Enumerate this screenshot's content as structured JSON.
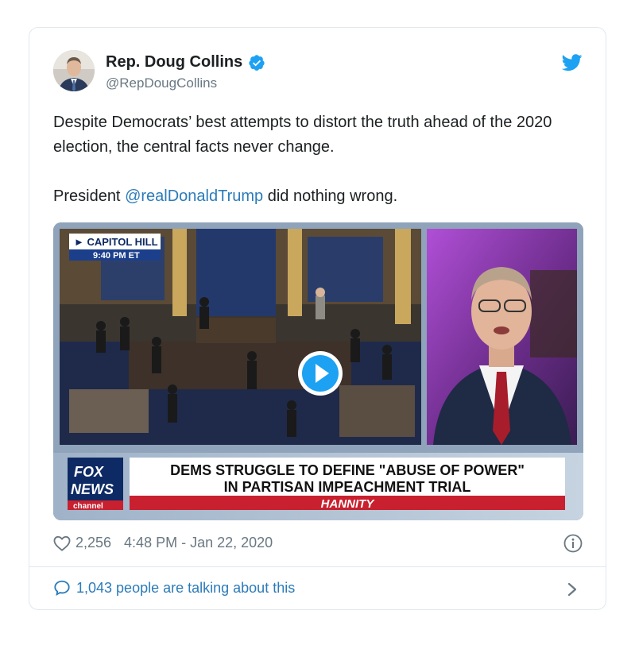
{
  "tweet": {
    "author_name": "Rep. Doug Collins",
    "handle": "@RepDougCollins",
    "text_line1": "Despite Democrats’ best attempts to distort the truth ahead of the 2020 election, the central facts never change.",
    "text_line2_prefix": "President ",
    "mention": "@realDonaldTrump",
    "text_line2_suffix": " did nothing wrong.",
    "likes": "2,256",
    "timestamp": "4:48 PM - Jan 22, 2020",
    "talking": "1,043 people are talking about this"
  },
  "video": {
    "location_tag": "► CAPITOL HILL",
    "time_tag": "9:40 PM ET",
    "headline_line1": "DEMS STRUGGLE TO DEFINE \"ABUSE OF POWER\"",
    "headline_line2": "IN PARTISAN IMPEACHMENT TRIAL",
    "show_name": "HANNITY",
    "logo_line1": "FOX",
    "logo_line2": "NEWS",
    "logo_line3": "channel"
  },
  "icons": {
    "verified": "verified-badge-icon",
    "bird": "twitter-bird-icon",
    "play": "play-icon",
    "heart": "heart-icon",
    "info": "info-icon",
    "bubble": "speech-bubble-icon",
    "chevron": "chevron-right-icon"
  },
  "colors": {
    "link": "#2b7bb9",
    "muted": "#697882",
    "twitter_blue": "#1da1f2",
    "fox_red": "#c8202e",
    "fox_navy": "#0e2a64"
  }
}
